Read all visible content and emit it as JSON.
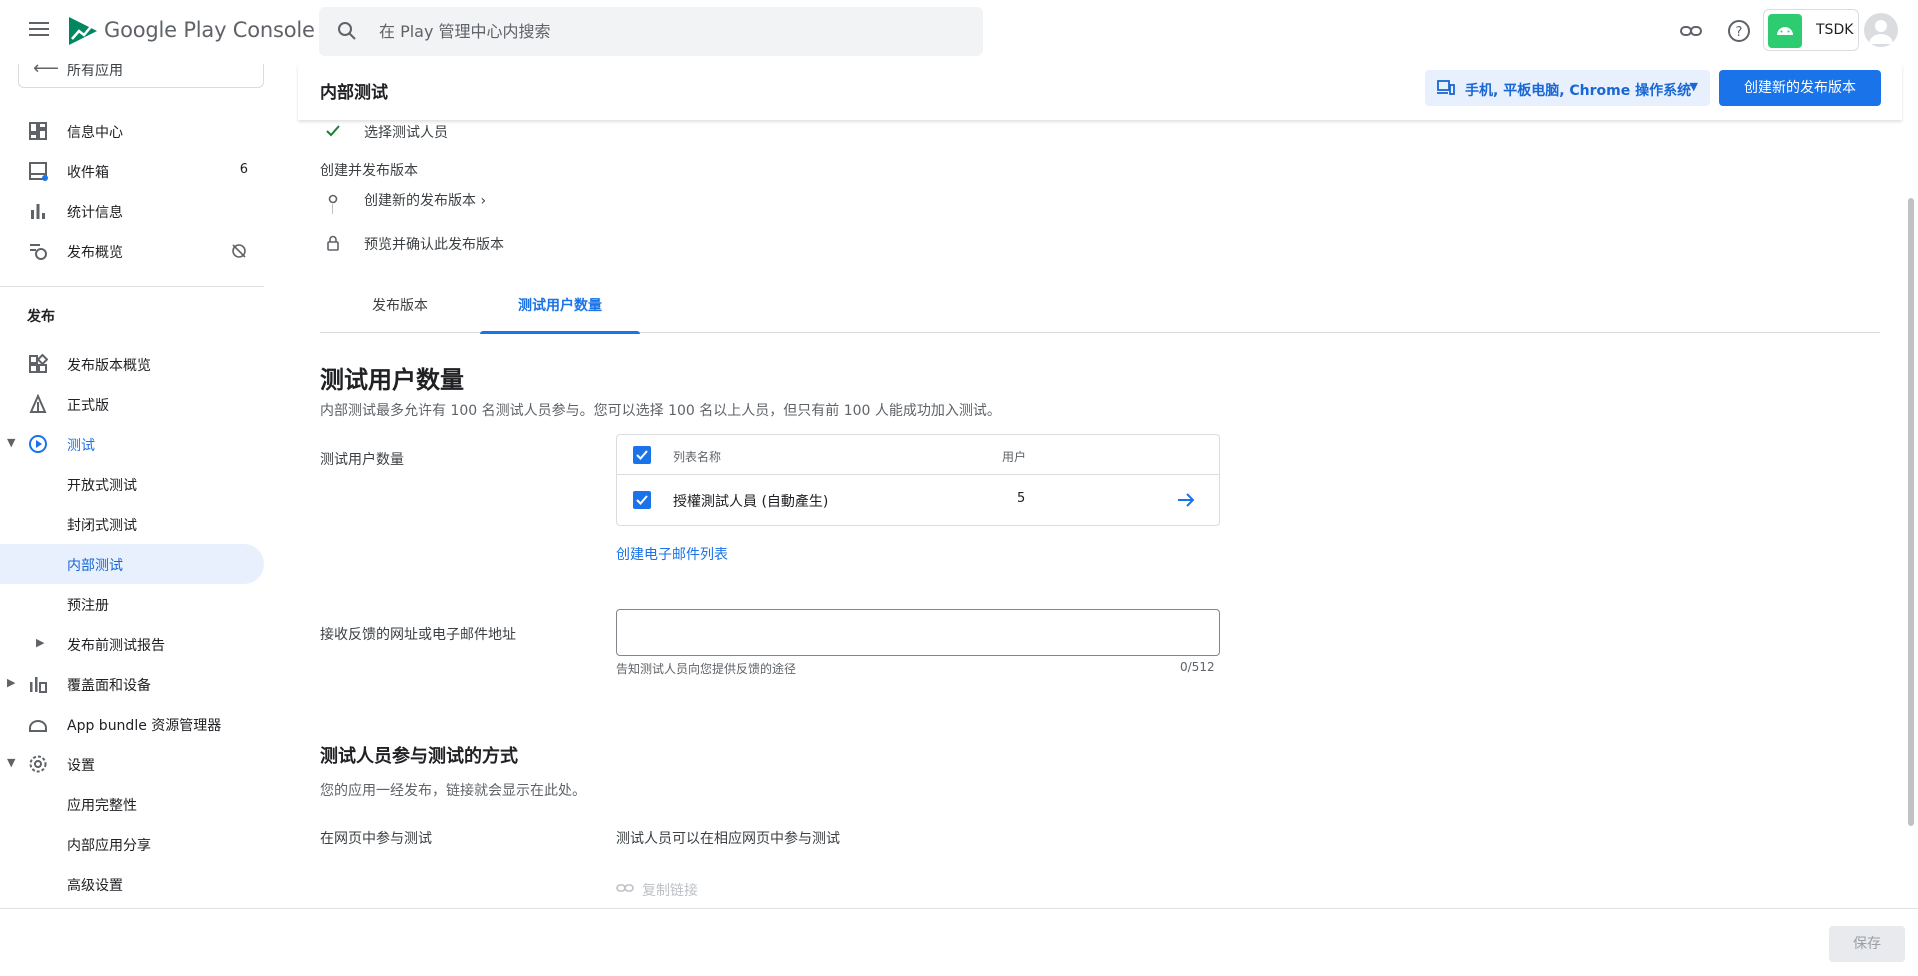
{
  "app": {
    "brand": "Google Play Console",
    "current_app": "TSDK"
  },
  "search": {
    "placeholder": "在 Play 管理中心内搜索"
  },
  "sidebar": {
    "back_label": "所有应用",
    "top_items": [
      {
        "label": "信息中心",
        "icon": "dashboard-icon"
      },
      {
        "label": "收件箱",
        "icon": "inbox-icon",
        "badge": "6"
      },
      {
        "label": "统计信息",
        "icon": "bar-chart-icon"
      },
      {
        "label": "发布概览",
        "icon": "publishing-overview-icon"
      }
    ],
    "section_publish": "发布",
    "publish_items": [
      {
        "label": "发布版本概览",
        "icon": "releases-overview-icon"
      },
      {
        "label": "正式版",
        "icon": "production-icon"
      },
      {
        "label": "测试",
        "icon": "testing-icon"
      },
      {
        "label": "开放式测试"
      },
      {
        "label": "封闭式测试"
      },
      {
        "label": "内部测试"
      },
      {
        "label": "预注册"
      },
      {
        "label": "发布前测试报告"
      },
      {
        "label": "覆盖面和设备",
        "icon": "reach-devices-icon"
      },
      {
        "label": "App bundle 资源管理器",
        "icon": "app-bundle-icon"
      },
      {
        "label": "设置",
        "icon": "gear-icon"
      },
      {
        "label": "应用完整性"
      },
      {
        "label": "内部应用分享"
      },
      {
        "label": "高级设置"
      }
    ]
  },
  "header": {
    "title": "内部测试",
    "device_selector": "手机, 平板电脑, Chrome 操作系统",
    "create_release": "创建新的发布版本"
  },
  "steps": {
    "select_testers": "选择测试人员",
    "group_label": "创建并发布版本",
    "create_release": "创建新的发布版本",
    "create_release_chevron": "›",
    "preview_confirm": "预览并确认此发布版本"
  },
  "tabs": [
    {
      "label": "发布版本",
      "active": false
    },
    {
      "label": "测试用户数量",
      "active": true
    }
  ],
  "testers": {
    "heading": "测试用户数量",
    "description": "内部测试最多允许有 100 名测试人员参与。您可以选择 100 名以上人员，但只有前 100 人能成功加入测试。",
    "field_label": "测试用户数量",
    "table": {
      "col_name": "列表名称",
      "col_users": "用户",
      "rows": [
        {
          "name": "授權測試人員 (自動產生)",
          "users": "5",
          "checked": true
        }
      ]
    },
    "create_email_list": "创建电子邮件列表",
    "feedback_label": "接收反馈的网址或电子邮件地址",
    "feedback_value": "",
    "feedback_hint": "告知测试人员向您提供反馈的途径",
    "feedback_counter": "0/512"
  },
  "join": {
    "heading": "测试人员参与测试的方式",
    "description": "您的应用一经发布，链接就会显示在此处。",
    "web_label": "在网页中参与测试",
    "web_value": "测试人员可以在相应网页中参与测试",
    "copy_link": "复制链接"
  },
  "footer": {
    "save": "保存"
  },
  "colors": {
    "accent": "#1a73e8",
    "accent_bg": "#e8f0fe",
    "android_green": "#2ecc71"
  }
}
